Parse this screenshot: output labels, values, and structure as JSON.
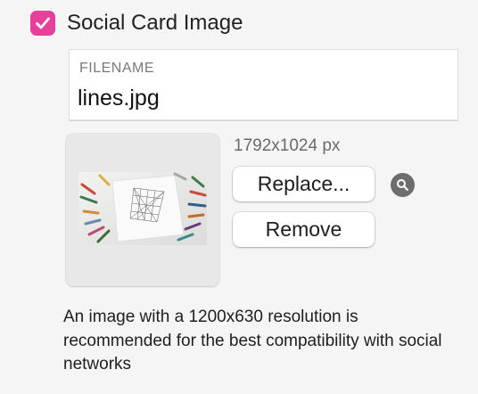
{
  "social_card": {
    "checkbox_checked": true,
    "accent_color": "#e6409c",
    "title": "Social Card Image"
  },
  "filename": {
    "label": "FILENAME",
    "value": "lines.jpg"
  },
  "image": {
    "dimensions": "1792x1024 px",
    "thumbnail_description_icon": "crayons-drawing-thumbnail"
  },
  "actions": {
    "replace_label": "Replace...",
    "remove_label": "Remove",
    "preview_icon": "magnifier-icon"
  },
  "help": {
    "text": "An image with a 1200x630 resolution is recommended for the best compatibility with social networks"
  }
}
